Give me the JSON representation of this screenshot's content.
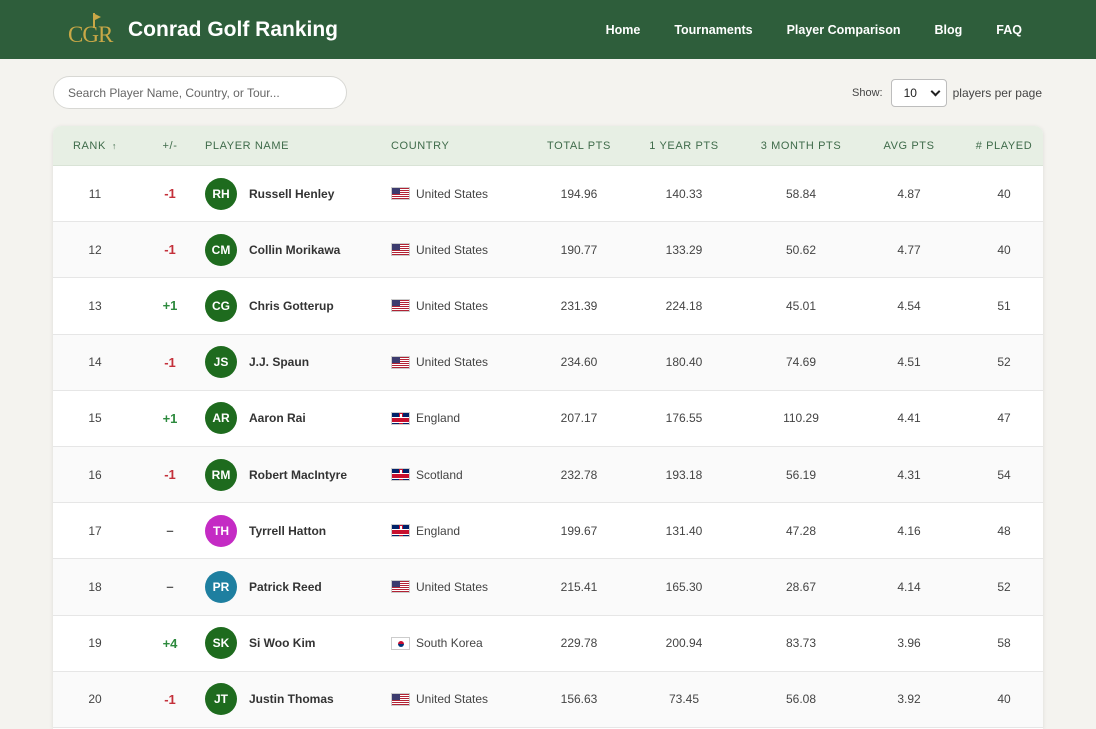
{
  "brand": {
    "logo_text": "CGR",
    "name": "Conrad Golf Ranking"
  },
  "nav": [
    "Home",
    "Tournaments",
    "Player Comparison",
    "Blog",
    "FAQ"
  ],
  "search": {
    "placeholder": "Search Player Name, Country, or Tour...",
    "value": ""
  },
  "pagination": {
    "show_label": "Show:",
    "per_page": "10",
    "suffix": "players per page"
  },
  "table": {
    "sort_indicator": "↑",
    "headers": [
      "Rank",
      "+/-",
      "Player Name",
      "Country",
      "Total Pts",
      "1 Year Pts",
      "3 Month Pts",
      "Avg Pts",
      "# Played"
    ],
    "rows": [
      {
        "rank": "11",
        "change": "-1",
        "dir": "down",
        "initials": "RH",
        "avatar_color": "#1e6b1e",
        "name": "Russell Henley",
        "flag": "us",
        "country": "United States",
        "total": "194.96",
        "year": "140.33",
        "month": "58.84",
        "avg": "4.87",
        "played": "40"
      },
      {
        "rank": "12",
        "change": "-1",
        "dir": "down",
        "initials": "CM",
        "avatar_color": "#1e6b1e",
        "name": "Collin Morikawa",
        "flag": "us",
        "country": "United States",
        "total": "190.77",
        "year": "133.29",
        "month": "50.62",
        "avg": "4.77",
        "played": "40"
      },
      {
        "rank": "13",
        "change": "+1",
        "dir": "up",
        "initials": "CG",
        "avatar_color": "#1e6b1e",
        "name": "Chris Gotterup",
        "flag": "us",
        "country": "United States",
        "total": "231.39",
        "year": "224.18",
        "month": "45.01",
        "avg": "4.54",
        "played": "51"
      },
      {
        "rank": "14",
        "change": "-1",
        "dir": "down",
        "initials": "JS",
        "avatar_color": "#1e6b1e",
        "name": "J.J. Spaun",
        "flag": "us",
        "country": "United States",
        "total": "234.60",
        "year": "180.40",
        "month": "74.69",
        "avg": "4.51",
        "played": "52"
      },
      {
        "rank": "15",
        "change": "+1",
        "dir": "up",
        "initials": "AR",
        "avatar_color": "#1e6b1e",
        "name": "Aaron Rai",
        "flag": "uk",
        "country": "England",
        "total": "207.17",
        "year": "176.55",
        "month": "110.29",
        "avg": "4.41",
        "played": "47"
      },
      {
        "rank": "16",
        "change": "-1",
        "dir": "down",
        "initials": "RM",
        "avatar_color": "#1e6b1e",
        "name": "Robert MacIntyre",
        "flag": "uk",
        "country": "Scotland",
        "total": "232.78",
        "year": "193.18",
        "month": "56.19",
        "avg": "4.31",
        "played": "54"
      },
      {
        "rank": "17",
        "change": "–",
        "dir": "same",
        "initials": "TH",
        "avatar_color": "#c42bc4",
        "name": "Tyrrell Hatton",
        "flag": "uk",
        "country": "England",
        "total": "199.67",
        "year": "131.40",
        "month": "47.28",
        "avg": "4.16",
        "played": "48"
      },
      {
        "rank": "18",
        "change": "–",
        "dir": "same",
        "initials": "PR",
        "avatar_color": "#1e7fa0",
        "name": "Patrick Reed",
        "flag": "us",
        "country": "United States",
        "total": "215.41",
        "year": "165.30",
        "month": "28.67",
        "avg": "4.14",
        "played": "52"
      },
      {
        "rank": "19",
        "change": "+4",
        "dir": "up",
        "initials": "SK",
        "avatar_color": "#1e6b1e",
        "name": "Si Woo Kim",
        "flag": "kr",
        "country": "South Korea",
        "total": "229.78",
        "year": "200.94",
        "month": "83.73",
        "avg": "3.96",
        "played": "58"
      },
      {
        "rank": "20",
        "change": "-1",
        "dir": "down",
        "initials": "JT",
        "avatar_color": "#1e6b1e",
        "name": "Justin Thomas",
        "flag": "us",
        "country": "United States",
        "total": "156.63",
        "year": "73.45",
        "month": "56.08",
        "avg": "3.92",
        "played": "40"
      }
    ]
  }
}
